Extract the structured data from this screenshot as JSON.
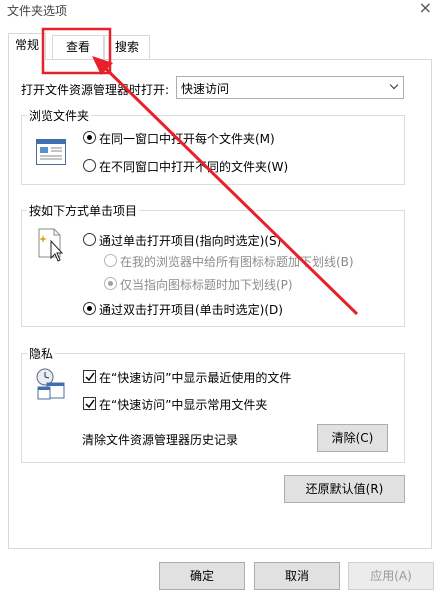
{
  "window": {
    "title": "文件夹选项",
    "close": "×"
  },
  "tabs": [
    {
      "label": "常规"
    },
    {
      "label": "查看"
    },
    {
      "label": "搜索"
    }
  ],
  "open_with": {
    "label": "打开文件资源管理器时打开:",
    "value": "快速访问"
  },
  "browse": {
    "title": "浏览文件夹",
    "opt1": "在同一窗口中打开每个文件夹(M)",
    "opt2": "在不同窗口中打开不同的文件夹(W)"
  },
  "click": {
    "title": "按如下方式单击项目",
    "opt_single": "通过单击打开项目(指向时选定)(S)",
    "sub1": "在我的浏览器中给所有图标标题加下划线(B)",
    "sub2": "仅当指向图标标题时加下划线(P)",
    "opt_double": "通过双击打开项目(单击时选定)(D)"
  },
  "privacy": {
    "title": "隐私",
    "recent": "在“快速访问”中显示最近使用的文件",
    "frequent": "在“快速访问”中显示常用文件夹",
    "clear_label": "清除文件资源管理器历史记录",
    "clear_btn": "清除(C)"
  },
  "restore_btn": "还原默认值(R)",
  "footer": {
    "ok": "确定",
    "cancel": "取消",
    "apply": "应用(A)"
  },
  "colors": {
    "annotation": "#e8202a"
  }
}
